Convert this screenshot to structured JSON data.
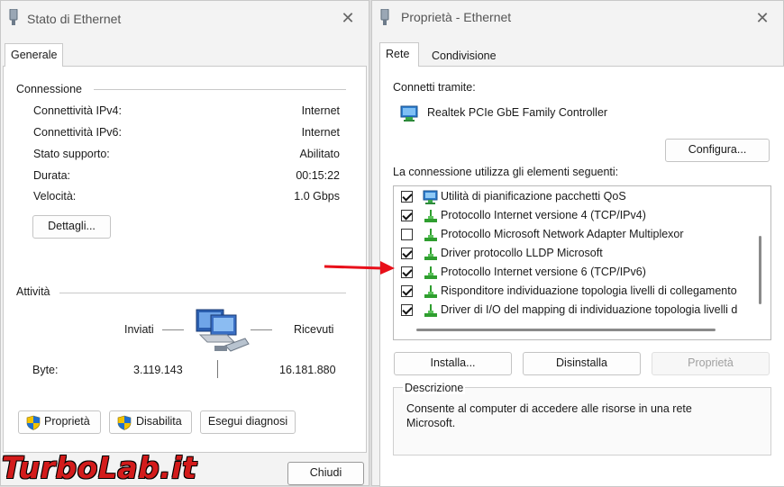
{
  "left_window": {
    "title": "Stato di Ethernet",
    "tab": "Generale",
    "connection_group": "Connessione",
    "rows": [
      {
        "label": "Connettività IPv4:",
        "value": "Internet"
      },
      {
        "label": "Connettività IPv6:",
        "value": "Internet"
      },
      {
        "label": "Stato supporto:",
        "value": "Abilitato"
      },
      {
        "label": "Durata:",
        "value": "00:15:22"
      },
      {
        "label": "Velocità:",
        "value": "1.0 Gbps"
      }
    ],
    "details_button": "Dettagli...",
    "activity_group": "Attività",
    "sent_label": "Inviati",
    "received_label": "Ricevuti",
    "bytes_label": "Byte:",
    "bytes_sent": "3.119.143",
    "bytes_received": "16.181.880",
    "properties_button": "Proprietà",
    "disable_button": "Disabilita",
    "diagnose_button": "Esegui diagnosi",
    "close_button": "Chiudi"
  },
  "right_window": {
    "title": "Proprietà - Ethernet",
    "tabs": [
      "Rete",
      "Condivisione"
    ],
    "connect_using_label": "Connetti tramite:",
    "adapter_name": "Realtek PCIe GbE Family Controller",
    "configure_button": "Configura...",
    "items_label": "La connessione utilizza gli elementi seguenti:",
    "items": [
      {
        "label": "Utilità di pianificazione pacchetti QoS",
        "checked": true,
        "icon": "qos-icon"
      },
      {
        "label": "Protocollo Internet versione 4 (TCP/IPv4)",
        "checked": true,
        "icon": "protocol-icon"
      },
      {
        "label": "Protocollo Microsoft Network Adapter Multiplexor",
        "checked": false,
        "icon": "protocol-icon"
      },
      {
        "label": "Driver protocollo LLDP Microsoft",
        "checked": true,
        "icon": "protocol-icon"
      },
      {
        "label": "Protocollo Internet versione 6 (TCP/IPv6)",
        "checked": true,
        "icon": "protocol-icon"
      },
      {
        "label": "Risponditore individuazione topologia livelli di collegamento",
        "checked": true,
        "icon": "protocol-icon"
      },
      {
        "label": "Driver di I/O del mapping di individuazione topologia livelli d",
        "checked": true,
        "icon": "protocol-icon"
      }
    ],
    "install_button": "Installa...",
    "uninstall_button": "Disinstalla",
    "properties_button": "Proprietà",
    "description_group": "Descrizione",
    "description_text": "Consente al computer di accedere alle risorse in una rete Microsoft."
  },
  "watermark": "TurboLab.it",
  "colors": {
    "arrow": "#e8101a",
    "protocol_green": "#2f9e2f",
    "shield_blue": "#1f6fd0",
    "shield_yellow": "#f2c200"
  }
}
